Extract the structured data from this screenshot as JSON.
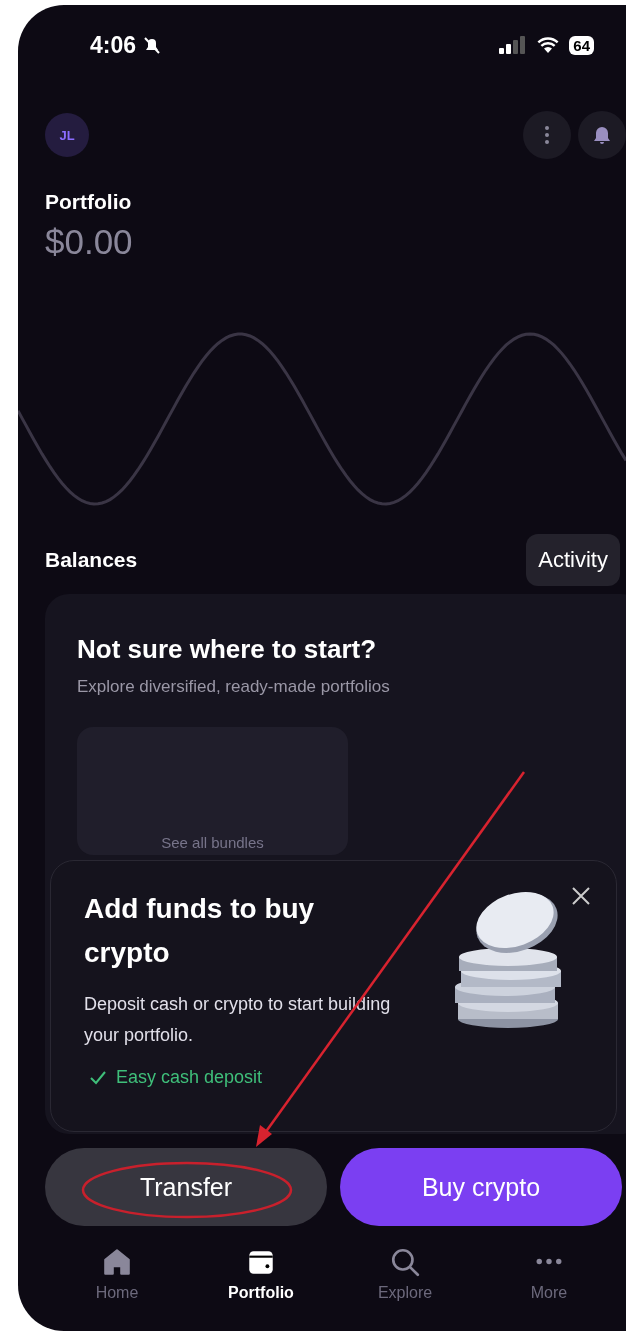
{
  "status_bar": {
    "time": "4:06",
    "battery": "64"
  },
  "header": {
    "avatar": "JL"
  },
  "portfolio": {
    "title": "Portfolio",
    "value": "$0.00"
  },
  "balances": {
    "title": "Balances",
    "activity": "Activity"
  },
  "promo_card": {
    "title": "Not sure where to start?",
    "subtitle": "Explore diversified, ready-made portfolios",
    "tile_label": "See all bundles"
  },
  "popup": {
    "title": "Add funds to buy crypto",
    "body": "Deposit cash or crypto to start building your portfolio.",
    "feature": "Easy cash deposit"
  },
  "actions": [
    {
      "label": "Transfer",
      "kind": "secondary"
    },
    {
      "label": "Buy crypto",
      "kind": "primary"
    }
  ],
  "nav": [
    {
      "label": "Home",
      "kind": "home",
      "selected": false
    },
    {
      "label": "Portfolio",
      "kind": "wallet",
      "selected": true
    },
    {
      "label": "Explore",
      "kind": "search",
      "selected": false
    },
    {
      "label": "More",
      "kind": "more",
      "selected": false
    }
  ]
}
